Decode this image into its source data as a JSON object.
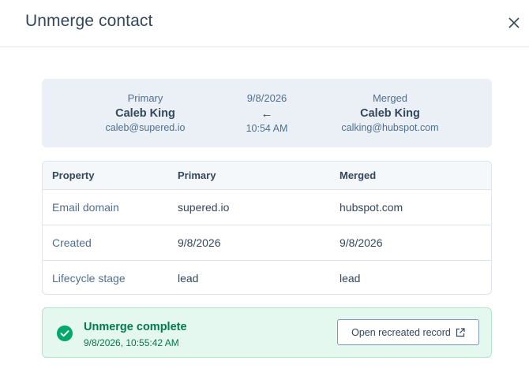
{
  "dialog": {
    "title": "Unmerge contact"
  },
  "summary": {
    "primary": {
      "label": "Primary",
      "name": "Caleb King",
      "email": "caleb@supered.io"
    },
    "middle": {
      "date": "9/8/2026",
      "arrow": "←",
      "time": "10:54 AM"
    },
    "merged": {
      "label": "Merged",
      "name": "Caleb King",
      "email": "calking@hubspot.com"
    }
  },
  "table": {
    "headers": [
      "Property",
      "Primary",
      "Merged"
    ],
    "rows": [
      [
        "Email domain",
        "supered.io",
        "hubspot.com"
      ],
      [
        "Created",
        "9/8/2026",
        "9/8/2026"
      ],
      [
        "Lifecycle stage",
        "lead",
        "lead"
      ]
    ]
  },
  "status": {
    "title": "Unmerge complete",
    "timestamp": "9/8/2026, 10:55:42 AM",
    "button_label": "Open recreated record"
  },
  "colors": {
    "success": "#00794f",
    "success_bg": "#e5f8f0",
    "summary_bg": "#eaf0f6"
  },
  "icons": {
    "close": "close-icon",
    "check": "check-circle-icon",
    "external": "external-link-icon"
  }
}
